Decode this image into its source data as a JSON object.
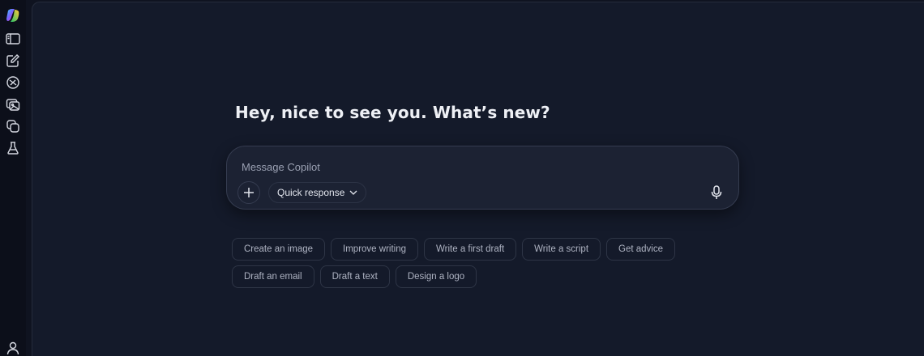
{
  "sidebar": {
    "items": [
      {
        "name": "copilot-logo-icon"
      },
      {
        "name": "sidebar-toggle-icon"
      },
      {
        "name": "new-chat-icon"
      },
      {
        "name": "discover-icon"
      },
      {
        "name": "image-gallery-icon"
      },
      {
        "name": "pages-icon"
      },
      {
        "name": "labs-icon"
      }
    ],
    "profile_icon": "profile-icon"
  },
  "main": {
    "greeting": "Hey, nice to see you. What’s new?"
  },
  "composer": {
    "placeholder": "Message Copilot",
    "value": "",
    "mode_label": "Quick response",
    "add_icon": "plus-icon",
    "mic_icon": "microphone-icon"
  },
  "suggestions": {
    "row1": [
      "Create an image",
      "Improve writing",
      "Write a first draft",
      "Write a script",
      "Get advice"
    ],
    "row2": [
      "Draft an email",
      "Draft a text",
      "Design a logo"
    ]
  },
  "colors": {
    "background": "#141a2a",
    "sidebar": "#0c0f1a",
    "composer": "#1c2233",
    "text": "#eef0f5",
    "muted_text": "#aeb3c2"
  }
}
